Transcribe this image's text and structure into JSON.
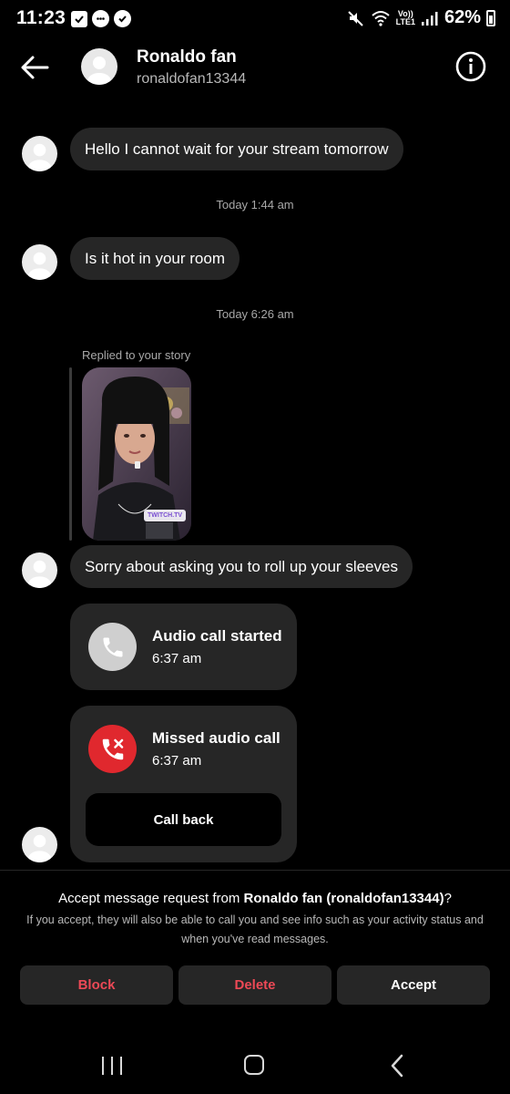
{
  "status_bar": {
    "time": "11:23",
    "network": "LTE1",
    "volte": "Vo))",
    "signal_gen": "6",
    "battery": "62%"
  },
  "header": {
    "name": "Ronaldo fan",
    "username": "ronaldofan13344",
    "icons": [
      "back-arrow-icon",
      "info-icon"
    ]
  },
  "messages": {
    "m1": "Hello I cannot wait for your stream tomorrow",
    "ts1": "Today 1:44 am",
    "m2": "Is it hot in your room",
    "ts2": "Today 6:26 am",
    "replied_label": "Replied to your story",
    "story_tag": "TWITCH.TV",
    "m3": "Sorry about asking you to roll up your sleeves"
  },
  "calls": {
    "audio": {
      "title": "Audio call started",
      "time": "6:37 am"
    },
    "missed": {
      "title": "Missed audio call",
      "time": "6:37 am",
      "callback": "Call back"
    }
  },
  "request": {
    "prefix": "Accept message request from ",
    "name_bold": "Ronaldo fan (ronaldofan13344)",
    "suffix": "?",
    "description": "If you accept, they will also be able to call you and see info such as your activity status and when you've read messages.",
    "block": "Block",
    "delete": "Delete",
    "accept": "Accept"
  },
  "colors": {
    "background": "#000000",
    "bubble": "#262626",
    "danger": "#ed4956",
    "missed_call": "#e0282e",
    "call_grey": "#cfcfcf",
    "secondary_text": "#a8a8a8"
  }
}
